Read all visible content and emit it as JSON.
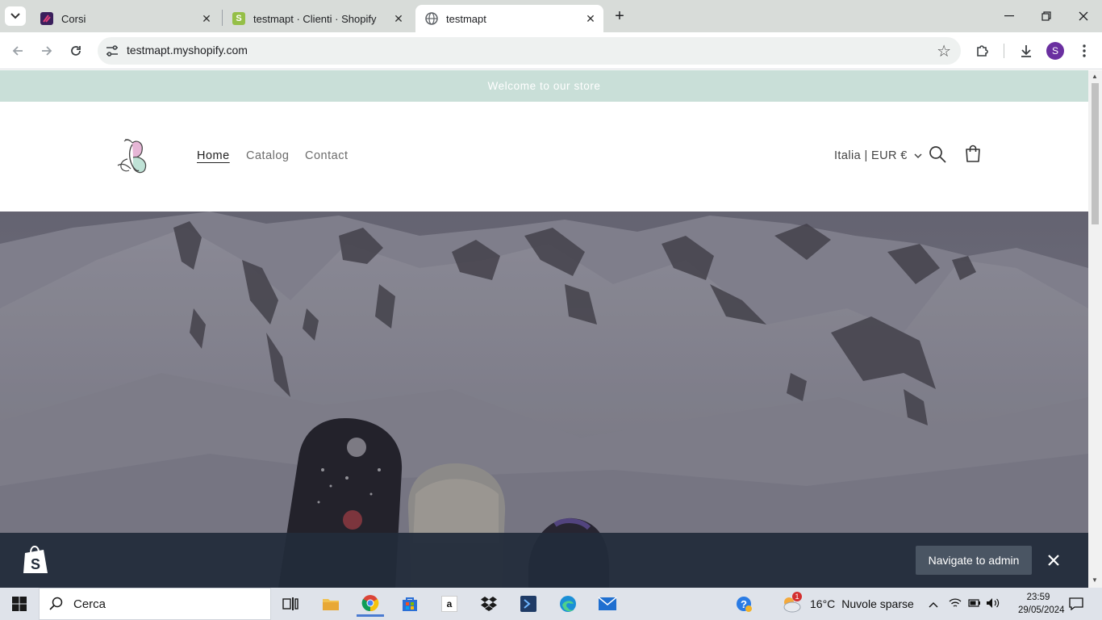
{
  "browser": {
    "tabs": [
      {
        "title": "Corsi",
        "favicon": "corsi-favicon",
        "active": false
      },
      {
        "title": "testmapt · Clienti · Shopify",
        "favicon": "shopify-favicon",
        "active": false
      },
      {
        "title": "testmapt",
        "favicon": "globe-favicon",
        "active": true
      }
    ],
    "url": "testmapt.myshopify.com",
    "profile_initial": "S"
  },
  "store": {
    "announcement": "Welcome to our store",
    "nav": [
      {
        "label": "Home",
        "active": true
      },
      {
        "label": "Catalog",
        "active": false
      },
      {
        "label": "Contact",
        "active": false
      }
    ],
    "locale": "Italia | EUR €"
  },
  "adminbar": {
    "button_label": "Navigate to admin"
  },
  "taskbar": {
    "search_placeholder": "Cerca",
    "weather_temp": "16°C",
    "weather_text": "Nuvole sparse",
    "weather_badge": "1",
    "time": "23:59",
    "date": "29/05/2024"
  },
  "colors": {
    "announcement_bg": "#c9dfd8",
    "adminbar_bg": "#222c3a",
    "shopify_green": "#95bf47"
  }
}
